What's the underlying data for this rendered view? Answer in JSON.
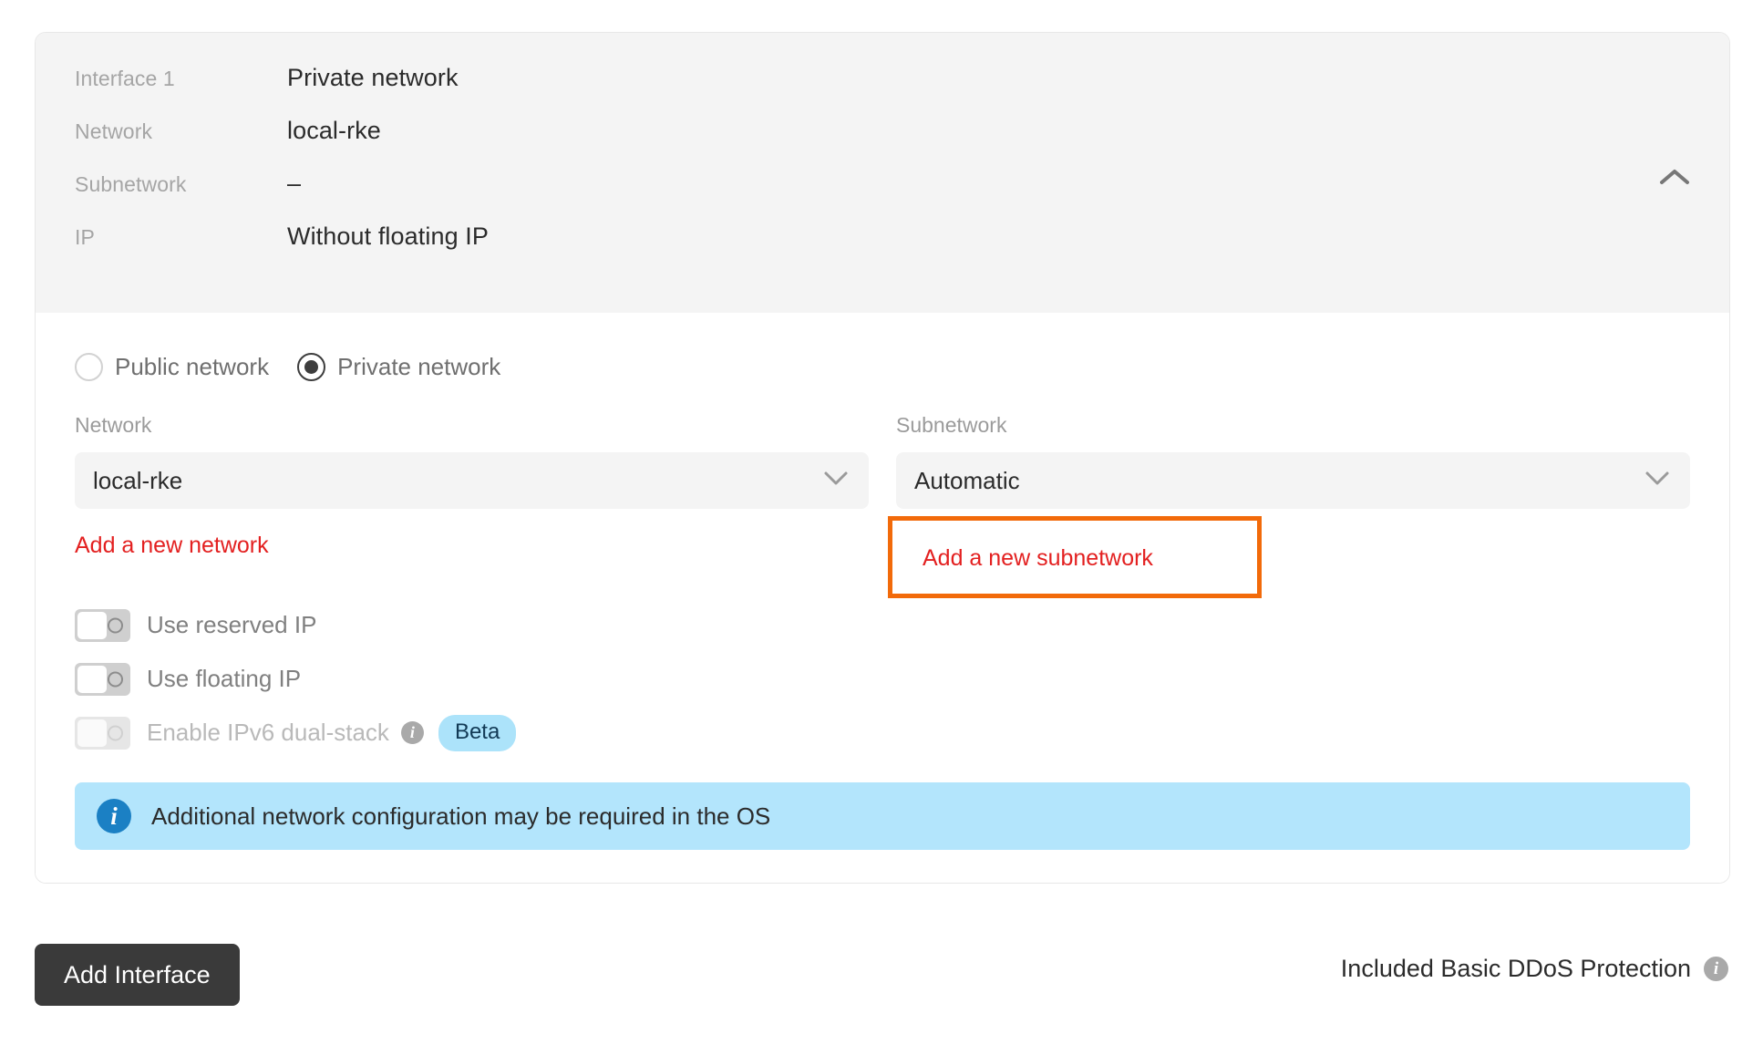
{
  "summary": {
    "rows": [
      {
        "label": "Interface 1",
        "value": "Private network"
      },
      {
        "label": "Network",
        "value": "local-rke"
      },
      {
        "label": "Subnetwork",
        "value": "–"
      },
      {
        "label": "IP",
        "value": "Without floating IP"
      }
    ],
    "collapse_icon": "chevron-up-icon"
  },
  "network_type": {
    "options": [
      {
        "label": "Public network",
        "selected": false
      },
      {
        "label": "Private network",
        "selected": true
      }
    ]
  },
  "fields": {
    "network": {
      "label": "Network",
      "value": "local-rke",
      "caret_icon": "chevron-down-icon",
      "add_link": "Add a new network"
    },
    "subnetwork": {
      "label": "Subnetwork",
      "value": "Automatic",
      "caret_icon": "chevron-down-icon",
      "add_link": "Add a new subnetwork"
    }
  },
  "toggles": [
    {
      "label": "Use reserved IP",
      "on": false,
      "disabled": false
    },
    {
      "label": "Use floating IP",
      "on": false,
      "disabled": false
    },
    {
      "label": "Enable IPv6 dual-stack",
      "on": false,
      "disabled": true,
      "info": true,
      "badge": "Beta"
    }
  ],
  "banner": {
    "icon": "info-icon",
    "text": "Additional network configuration may be required in the OS"
  },
  "footer": {
    "add_interface_label": "Add Interface",
    "ddos_text": "Included Basic DDoS Protection",
    "ddos_info_icon": "info-icon"
  },
  "colors": {
    "highlight_box": "#f26a0a",
    "link_red": "#e32020",
    "banner_bg": "#b3e5fc",
    "badge_bg": "#ace3fa",
    "button_bg": "#3a3a3a",
    "panel_gray": "#f4f4f4"
  }
}
